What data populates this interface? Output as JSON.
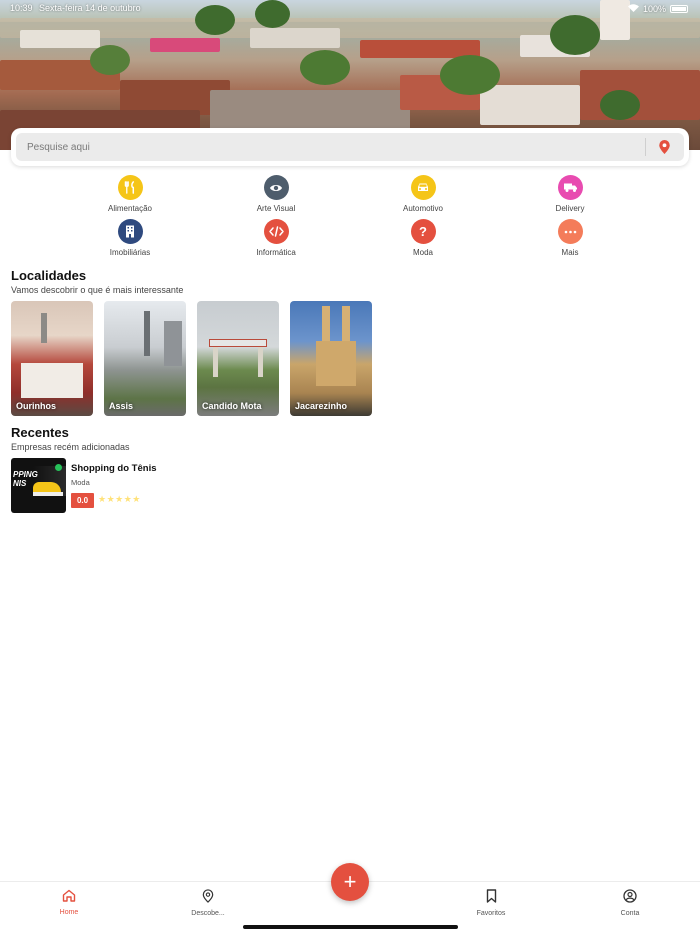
{
  "status_bar": {
    "time": "10:39",
    "date": "Sexta-feira 14 de outubro",
    "battery": "100%"
  },
  "search": {
    "placeholder": "Pesquise aqui"
  },
  "categories": [
    {
      "label": "Alimentação",
      "icon": "fork-knife-icon",
      "color": "#f5c518"
    },
    {
      "label": "Arte Visual",
      "icon": "eye-icon",
      "color": "#4e5d6c"
    },
    {
      "label": "Automotivo",
      "icon": "car-icon",
      "color": "#f5c518"
    },
    {
      "label": "Delivery",
      "icon": "truck-icon",
      "color": "#e84bb0"
    },
    {
      "label": "Imobiliárias",
      "icon": "building-icon",
      "color": "#2f4a7f"
    },
    {
      "label": "Informática",
      "icon": "code-icon",
      "color": "#e4503f"
    },
    {
      "label": "Moda",
      "icon": "question-icon",
      "color": "#e4503f"
    },
    {
      "label": "Mais",
      "icon": "more-icon",
      "color": "#f47c5a"
    }
  ],
  "localidades": {
    "title": "Localidades",
    "subtitle": "Vamos descobrir o que é mais interessante",
    "items": [
      {
        "name": "Ourinhos"
      },
      {
        "name": "Assis"
      },
      {
        "name": "Candido Mota"
      },
      {
        "name": "Jacarezinho"
      }
    ]
  },
  "recentes": {
    "title": "Recentes",
    "subtitle": "Empresas recém adicionadas",
    "items": [
      {
        "name": "Shopping do Tênis",
        "category": "Moda",
        "rating": "0.0",
        "stars": "★★★★★",
        "thumb_text": "PPING\nNIS"
      }
    ]
  },
  "tabbar": {
    "items": [
      {
        "label": "Home",
        "icon": "home-icon",
        "active": true
      },
      {
        "label": "Descobe...",
        "icon": "map-pin-icon",
        "active": false
      },
      {
        "label": "Favoritos",
        "icon": "bookmark-icon",
        "active": false
      },
      {
        "label": "Conta",
        "icon": "user-circle-icon",
        "active": false
      }
    ],
    "fab_label": "+"
  },
  "colors": {
    "accent": "#e4503f",
    "star": "#ffe27a"
  }
}
